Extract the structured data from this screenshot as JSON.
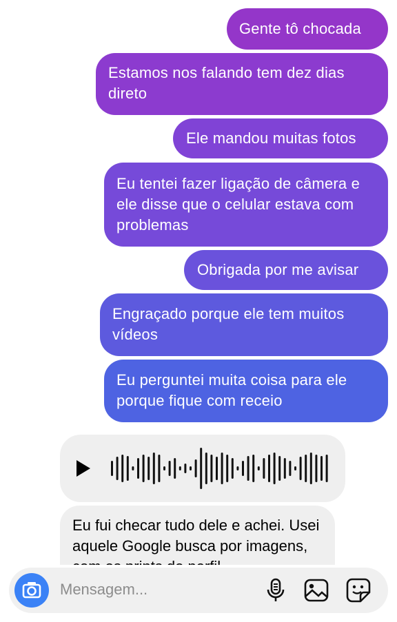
{
  "messages_outgoing": [
    "Gente tô chocada",
    "Estamos nos falando tem dez dias direto",
    "Ele mandou muitas fotos",
    "Eu tentei fazer ligação de câmera e ele disse que o celular estava com problemas",
    "Obrigada por me avisar",
    "Engraçado porque ele tem muitos vídeos",
    "Eu perguntei muita coisa para ele porque fique com receio"
  ],
  "audio_message": {
    "icon": "play-icon"
  },
  "message_incoming": "Eu fui checar tudo dele e achei. Usei aquele Google busca por imagens, com os prints do perfil",
  "composer": {
    "placeholder": "Mensagem...",
    "icons": [
      "camera-icon",
      "microphone-icon",
      "gallery-icon",
      "sticker-icon"
    ]
  },
  "colors": {
    "gradient_top": "#9436c9",
    "gradient_bottom": "#4e63e2",
    "camera_button": "#3b82f6",
    "incoming_bg": "#efefef"
  }
}
